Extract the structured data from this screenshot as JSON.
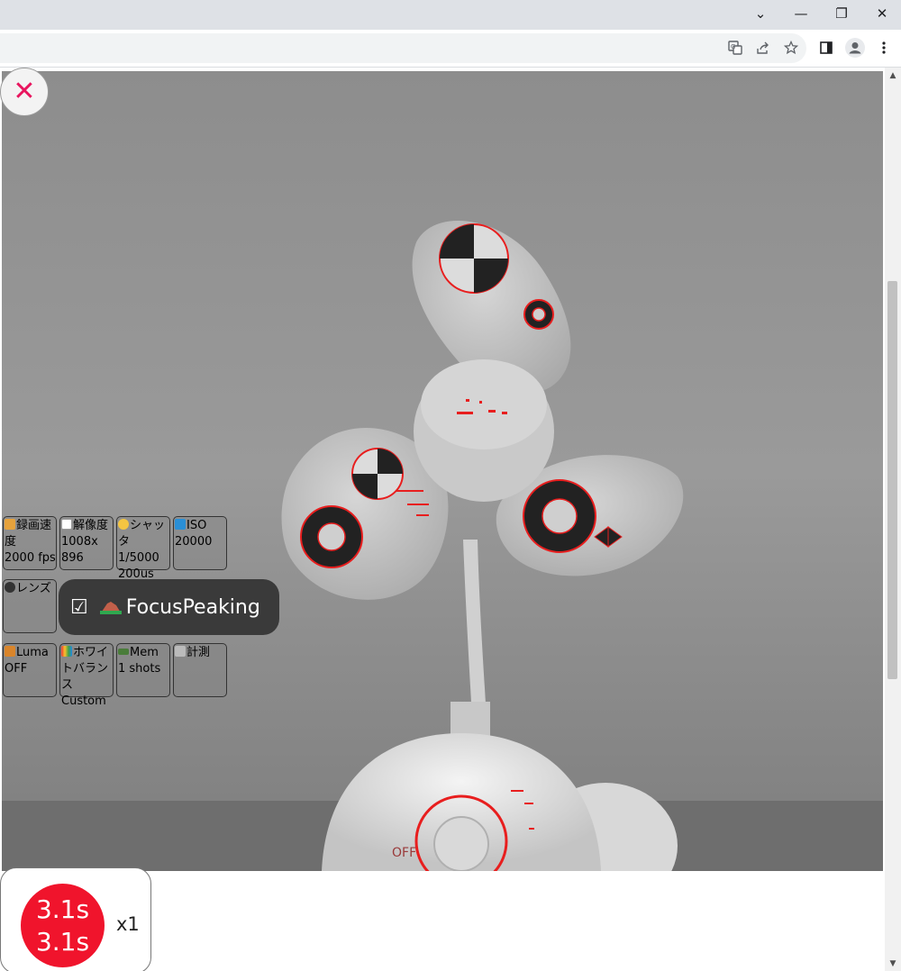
{
  "window_controls": {
    "tab_search": "⌄",
    "minimize": "—",
    "restore": "❐",
    "close": "✕"
  },
  "toolbar_icons": [
    "translate-icon",
    "share-icon",
    "bookmark-star-icon",
    "side-panel-icon",
    "profile-icon",
    "menu-dots-icon"
  ],
  "close_glyph": "✕",
  "controls": {
    "frame_rate": {
      "label": "録画速度",
      "value": "2000 fps"
    },
    "resolution": {
      "label": "解像度",
      "value": "1008x 896"
    },
    "shutter": {
      "label": "シャッタ",
      "value": "1/5000 200us"
    },
    "iso": {
      "label": "ISO",
      "value": "20000"
    },
    "lens": {
      "label": "レンズ",
      "value": ""
    },
    "luma": {
      "label": "Luma",
      "value": "OFF"
    },
    "white_balance": {
      "label": "ホワイトバランス",
      "value": "Custom"
    },
    "memory": {
      "label": "Mem",
      "value": "1 shots"
    },
    "measure": {
      "label": "計測",
      "value": ""
    }
  },
  "focus_peaking": {
    "checkbox": "☑",
    "label": "FocusPeaking"
  },
  "record": {
    "line1": "3.1s",
    "line2": "3.1s",
    "multiplier": "x1"
  },
  "feed_text": {
    "off_mark": "OFF"
  },
  "colors": {
    "accent_close": "#e8155e",
    "record_red": "#f0142c",
    "peaking": "#ff2a2a"
  }
}
